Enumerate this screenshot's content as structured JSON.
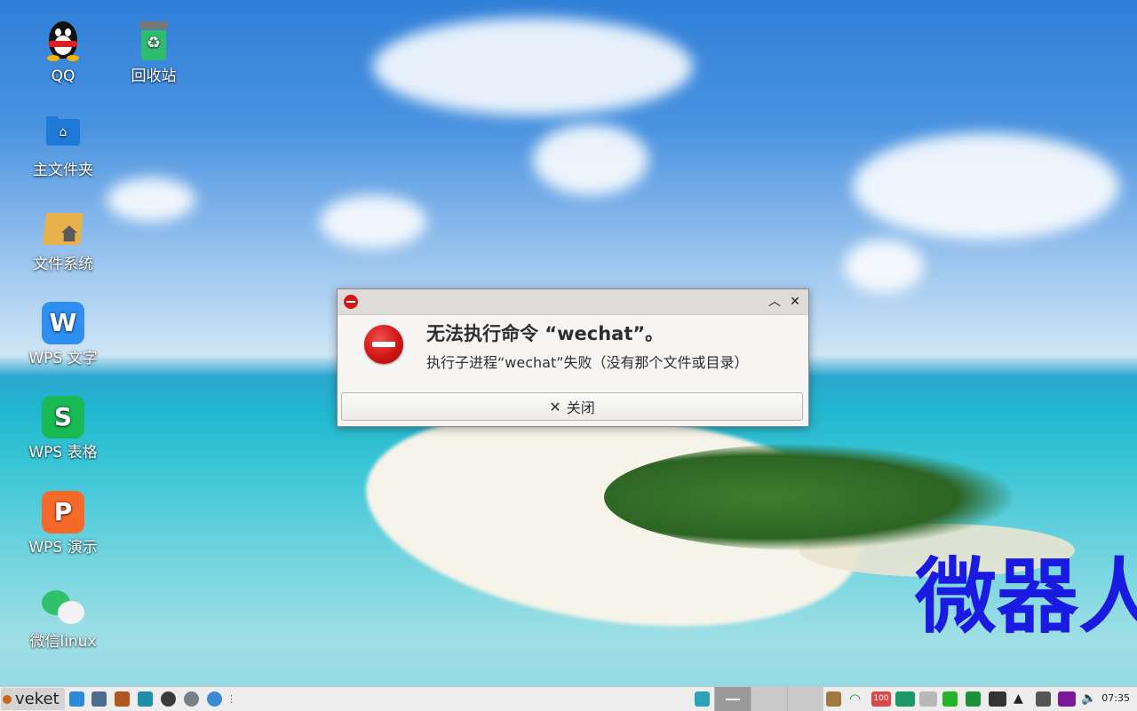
{
  "desktop": {
    "icons": [
      {
        "label": "QQ"
      },
      {
        "label": "回收站"
      },
      {
        "label": "主文件夹"
      },
      {
        "label": "文件系统"
      },
      {
        "label": "WPS 文字"
      },
      {
        "label": "WPS 表格"
      },
      {
        "label": "WPS 演示"
      },
      {
        "label": "微信linux"
      }
    ],
    "watermark": "微器人"
  },
  "dialog": {
    "heading": "无法执行命令 “wechat”。",
    "message": "执行子进程“wechat”失败（没有那个文件或目录）",
    "close_label": "关闭",
    "colors": {
      "error": "#d01818"
    }
  },
  "taskbar": {
    "menu_label": "veket",
    "clock": "07:35",
    "battery_label": "100"
  }
}
